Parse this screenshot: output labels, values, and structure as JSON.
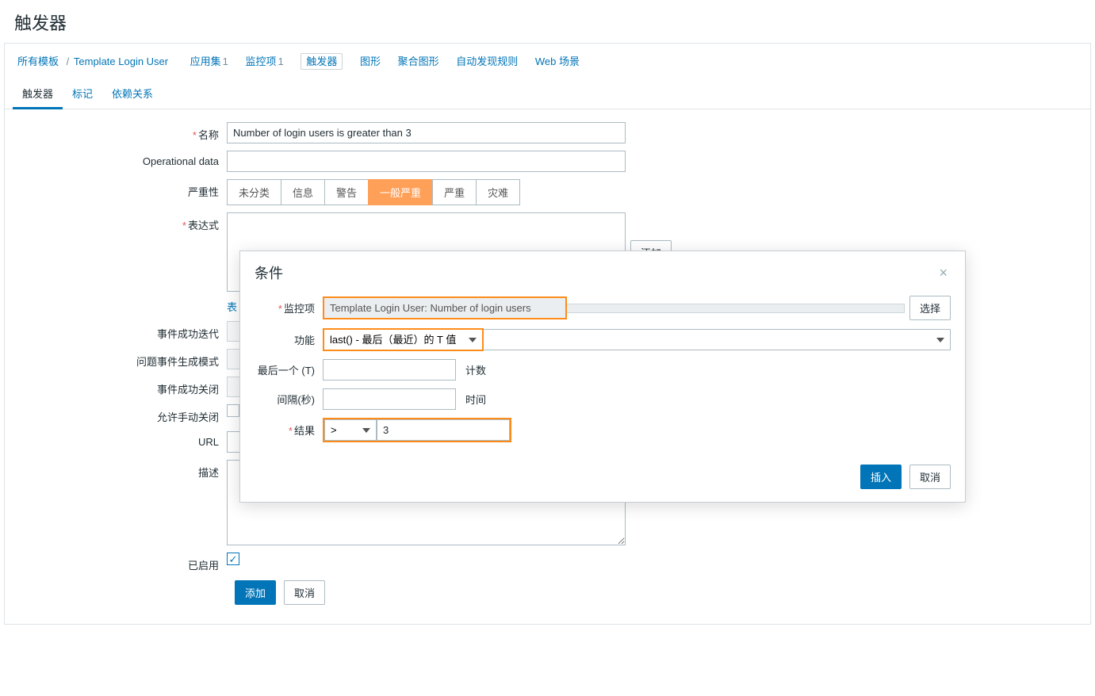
{
  "page": {
    "title": "触发器"
  },
  "breadcrumbs": {
    "root": "所有模板",
    "template": "Template Login User",
    "items": [
      {
        "label": "应用集",
        "count": "1"
      },
      {
        "label": "监控项",
        "count": "1"
      },
      {
        "label": "触发器",
        "count": "",
        "boxed": true
      },
      {
        "label": "图形",
        "count": ""
      },
      {
        "label": "聚合图形",
        "count": ""
      },
      {
        "label": "自动发现规则",
        "count": ""
      },
      {
        "label": "Web 场景",
        "count": ""
      }
    ]
  },
  "tabs": {
    "t0": "触发器",
    "t1": "标记",
    "t2": "依赖关系"
  },
  "form": {
    "name_label": "名称",
    "name_value": "Number of login users is greater than 3",
    "opdata_label": "Operational data",
    "opdata_value": "",
    "severity_label": "严重性",
    "severity_opts": {
      "s0": "未分类",
      "s1": "信息",
      "s2": "警告",
      "s3": "一般严重",
      "s4": "严重",
      "s5": "灾难"
    },
    "expression_label": "表达式",
    "expression_value": "",
    "expression_add": "添加",
    "expr_constructor": "表",
    "recovery_label": "事件成功迭代",
    "problem_mode_label": "问题事件生成模式",
    "ok_close_label": "事件成功关闭",
    "manual_close_label": "允许手动关闭",
    "url_label": "URL",
    "url_value": "",
    "desc_label": "描述",
    "desc_value": "",
    "enabled_label": "已启用",
    "add_btn": "添加",
    "cancel_btn": "取消"
  },
  "modal": {
    "title": "条件",
    "item_label": "监控项",
    "item_value": "Template Login User: Number of login users",
    "item_select": "选择",
    "func_label": "功能",
    "func_value": "last() - 最后（最近）的 T 值",
    "last_label": "最后一个 (T)",
    "last_value": "",
    "last_suffix": "计数",
    "interval_label": "间隔(秒)",
    "interval_value": "",
    "interval_suffix": "时间",
    "result_label": "结果",
    "result_op": ">",
    "result_value": "3",
    "insert_btn": "插入",
    "cancel_btn": "取消"
  }
}
